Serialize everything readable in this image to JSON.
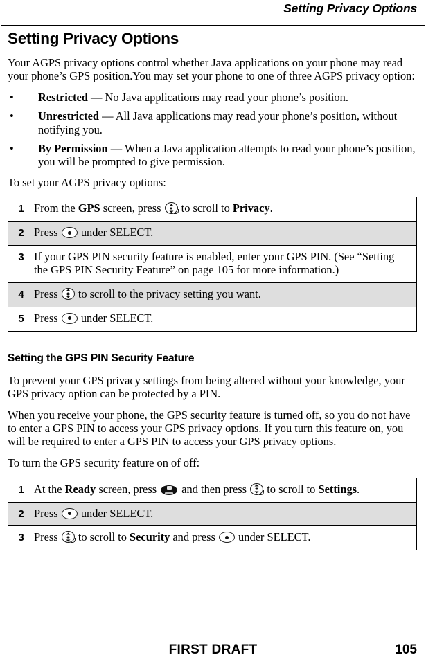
{
  "running_head": "Setting Privacy Options",
  "chapter_title": "Setting Privacy Options",
  "intro_paragraph": "Your AGPS privacy options control whether Java applications on your phone may read your phone’s GPS position.You may set your phone to one of three AGPS privacy option:",
  "bullets": [
    {
      "dot": "•",
      "term": "Restricted",
      "dash": " — ",
      "text": "No Java applications may read your phone’s position."
    },
    {
      "dot": "•",
      "term": "Unrestricted",
      "dash": " — ",
      "text": "All Java applications may read your phone’s position, without notifying you."
    },
    {
      "dot": "•",
      "term": "By Permission",
      "dash": " — ",
      "text": "When a Java application attempts to read your phone’s position, you will be prompted to give permission."
    }
  ],
  "lead_in_1": "To set your AGPS privacy options:",
  "steps_table_1": {
    "rows": [
      {
        "num": "1",
        "parts": [
          {
            "kind": "text",
            "value": "From the "
          },
          {
            "kind": "bold",
            "value": "GPS"
          },
          {
            "kind": "text",
            "value": " screen, press "
          },
          {
            "kind": "icon",
            "value": "scroll-key-icon"
          },
          {
            "kind": "text",
            "value": " to scroll to "
          },
          {
            "kind": "bold",
            "value": "Privacy"
          },
          {
            "kind": "text",
            "value": "."
          }
        ]
      },
      {
        "num": "2",
        "parts": [
          {
            "kind": "text",
            "value": "Press "
          },
          {
            "kind": "icon",
            "value": "select-key-icon"
          },
          {
            "kind": "text",
            "value": " under SELECT."
          }
        ]
      },
      {
        "num": "3",
        "parts": [
          {
            "kind": "text",
            "value": "If your GPS PIN security feature is enabled, enter your GPS PIN. (See “Setting the GPS PIN Security Feature” on page 105 for more information.)"
          }
        ]
      },
      {
        "num": "4",
        "parts": [
          {
            "kind": "text",
            "value": "Press "
          },
          {
            "kind": "icon",
            "value": "scroll-updown-key-icon"
          },
          {
            "kind": "text",
            "value": " to scroll to the privacy setting you want."
          }
        ]
      },
      {
        "num": "5",
        "parts": [
          {
            "kind": "text",
            "value": "Press "
          },
          {
            "kind": "icon",
            "value": "select-key-icon"
          },
          {
            "kind": "text",
            "value": " under SELECT."
          }
        ]
      }
    ]
  },
  "section_title": "Setting the GPS PIN Security Feature",
  "paragraph_2": "To prevent your GPS privacy settings from being altered without your knowledge, your GPS privacy option can be protected by a PIN.",
  "paragraph_3": "When you receive your phone, the GPS security feature is turned off, so you do not have to enter a GPS PIN to access your GPS privacy options. If you turn this feature on, you will be required to enter a GPS PIN to access your GPS privacy options.",
  "lead_in_2": "To turn the GPS security feature on of off:",
  "steps_table_2": {
    "rows": [
      {
        "num": "1",
        "parts": [
          {
            "kind": "text",
            "value": "At the "
          },
          {
            "kind": "bold",
            "value": "Ready"
          },
          {
            "kind": "text",
            "value": " screen, press "
          },
          {
            "kind": "icon",
            "value": "menu-key-icon"
          },
          {
            "kind": "text",
            "value": " and then press "
          },
          {
            "kind": "icon",
            "value": "scroll-key-icon"
          },
          {
            "kind": "text",
            "value": " to scroll to "
          },
          {
            "kind": "bold",
            "value": "Settings"
          },
          {
            "kind": "text",
            "value": "."
          }
        ]
      },
      {
        "num": "2",
        "parts": [
          {
            "kind": "text",
            "value": "Press "
          },
          {
            "kind": "icon",
            "value": "select-key-icon"
          },
          {
            "kind": "text",
            "value": " under SELECT."
          }
        ]
      },
      {
        "num": "3",
        "parts": [
          {
            "kind": "text",
            "value": "Press "
          },
          {
            "kind": "icon",
            "value": "scroll-key-icon"
          },
          {
            "kind": "text",
            "value": " to scroll to "
          },
          {
            "kind": "bold",
            "value": "Security"
          },
          {
            "kind": "text",
            "value": " and press "
          },
          {
            "kind": "icon",
            "value": "select-key-icon"
          },
          {
            "kind": "text",
            "value": " under SELECT."
          }
        ]
      }
    ]
  },
  "footer": {
    "draft_label": "FIRST DRAFT",
    "page_number": "105"
  },
  "colors": {
    "text": "#000000",
    "page_background": "#ffffff",
    "row_shade": "#dedede",
    "rule": "#000000"
  }
}
